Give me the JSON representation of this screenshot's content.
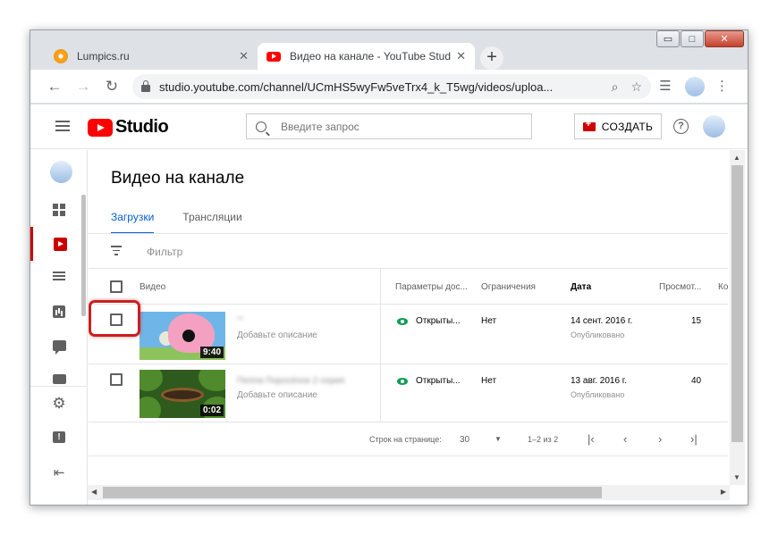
{
  "window": {
    "controls": {
      "minimize": "▭",
      "maximize": "□",
      "close": "✕"
    }
  },
  "tabs": [
    {
      "title": "Lumpics.ru",
      "close": "✕",
      "favicon": "lumpics-orange-icon"
    },
    {
      "title": "Видео на канале - YouTube Studio",
      "close": "✕",
      "favicon": "youtube-icon"
    }
  ],
  "new_tab": "+",
  "toolbar": {
    "back": "←",
    "forward": "→",
    "reload": "↻",
    "url": "studio.youtube.com/channel/UCmHS5wyFw5veTrx4_k_T5wg/videos/uploa...",
    "zoom_icon": "⌕",
    "star_icon": "☆",
    "media_icon": "☰",
    "menu_icon": "⋮"
  },
  "header": {
    "logo_text": "Studio",
    "search_placeholder": "Введите запрос",
    "create_label": "СОЗДАТЬ",
    "help": "?"
  },
  "page": {
    "title": "Видео на канале",
    "tabs": [
      {
        "label": "Загрузки",
        "active": true
      },
      {
        "label": "Трансляции",
        "active": false
      }
    ],
    "filter_placeholder": "Фильтр"
  },
  "table": {
    "columns": {
      "video": "Видео",
      "visibility": "Параметры дос...",
      "restrictions": "Ограничения",
      "date": "Дата",
      "views": "Просмот...",
      "comments": "Ко"
    },
    "rows": [
      {
        "title": "\"\"",
        "description": "Добавьте описание",
        "duration": "9:40",
        "visibility": "Открыты...",
        "restrictions": "Нет",
        "date": "14 сент. 2016 г.",
        "status": "Опубликовано",
        "views": "15"
      },
      {
        "title": "Пеппа Поросёнок 2 серия",
        "description": "Добавьте описание",
        "duration": "0:02",
        "visibility": "Открыты...",
        "restrictions": "Нет",
        "date": "13 авг. 2016 г.",
        "status": "Опубликовано",
        "views": "40"
      }
    ]
  },
  "pager": {
    "rows_label": "Строк на странице:",
    "rows_value": "30",
    "range": "1–2 из 2",
    "first": "|‹",
    "prev": "‹",
    "next": "›",
    "last": "›|"
  },
  "colors": {
    "accent_blue": "#065fd4",
    "youtube_red": "#ff0000",
    "visibility_green": "#0f9d58",
    "highlight_red": "#cc1e1e"
  }
}
